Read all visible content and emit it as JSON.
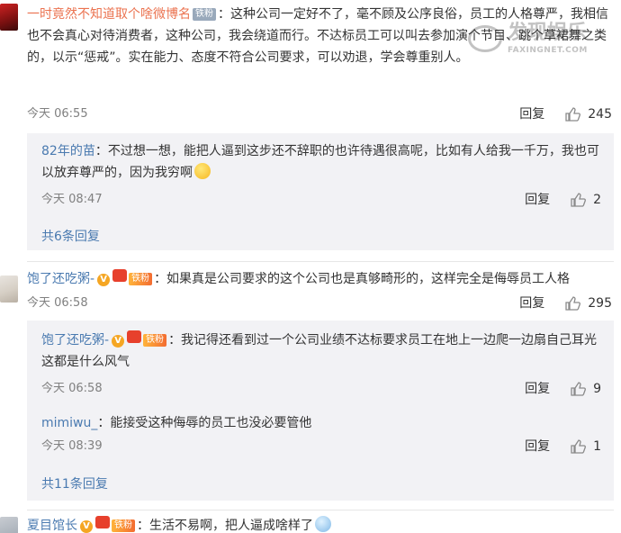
{
  "watermark": {
    "main": "发现娱乐",
    "sub": "FAXINGNET.COM"
  },
  "actions": {
    "reply_label": "回复"
  },
  "comments": [
    {
      "user": "一时竟然不知道取个啥微博名",
      "badge": "铁粉",
      "text": "：这种公司一定好不了，毫不顾及公序良俗，员工的人格尊严，我相信也不会真心对待消费者，这种公司，我会绕道而行。不达标员工可以叫去参加演个节目、跳个草裙舞之类的，以示“惩戒”。实在能力、态度不符合公司要求，可以劝退，学会尊重别人。",
      "time": "今天 06:55",
      "likes": "245",
      "replies": [
        {
          "user": "82年的苗",
          "text": "：不过想一想，能把人逼到这步还不辞职的也许待遇很高呢，比如有人给我一千万，我也可以放弃尊严的，因为我穷啊",
          "time": "今天 08:47",
          "likes": "2"
        }
      ],
      "more": "共6条回复"
    },
    {
      "user": "饱了还吃粥-",
      "badge": "铁粉",
      "text": "：如果真是公司要求的这个公司也是真够畸形的，这样完全是侮辱员工人格",
      "time": "今天 06:58",
      "likes": "295",
      "replies": [
        {
          "user": "饱了还吃粥-",
          "badge": "铁粉",
          "text": "：我记得还看到过一个公司业绩不达标要求员工在地上一边爬一边扇自己耳光 这都是什么风气",
          "time": "今天 06:58",
          "likes": "9"
        },
        {
          "user": "mimiwu_",
          "text": "：能接受这种侮辱的员工也没必要管他",
          "time": "今天 08:39",
          "likes": "1"
        }
      ],
      "more": "共11条回复"
    },
    {
      "user": "夏目馆长",
      "badge": "铁粉",
      "text": "：生活不易啊，把人逼成啥样了"
    }
  ]
}
